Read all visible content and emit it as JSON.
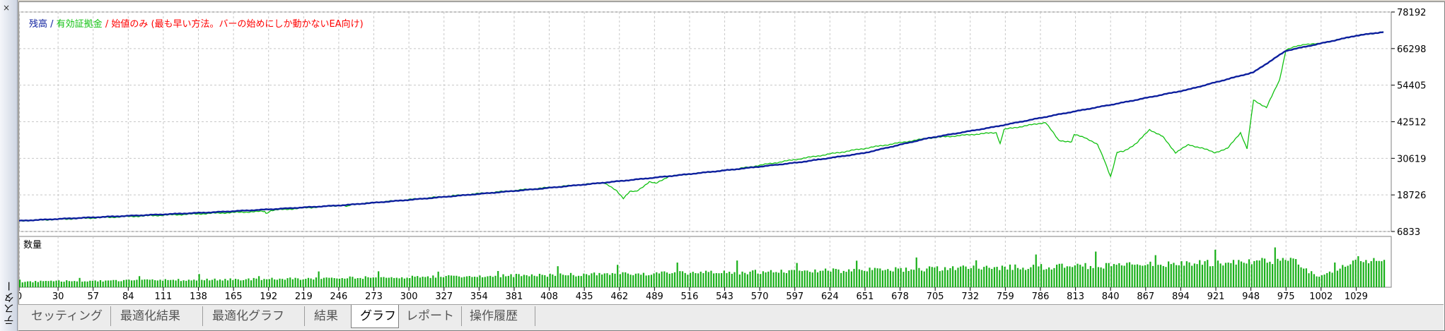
{
  "window": {
    "panel_title": "テスター",
    "close_glyph": "×"
  },
  "legend": {
    "balance": "残高",
    "sep1": " / ",
    "equity": "有効証拠金",
    "sep2": " / ",
    "note": "始値のみ (最も早い方法。バーの始めにしか動かないEA向け)"
  },
  "volume_label": "数量",
  "tabs": [
    {
      "label": "セッティング",
      "active": false
    },
    {
      "label": "最適化結果",
      "active": false
    },
    {
      "label": "最適化グラフ",
      "active": false
    },
    {
      "label": "結果",
      "active": false
    },
    {
      "label": "グラフ",
      "active": true
    },
    {
      "label": "レポート",
      "active": false
    },
    {
      "label": "操作履歴",
      "active": false
    }
  ],
  "colors": {
    "balance": "#0d1f9e",
    "equity": "#11c111",
    "note": "#ff0000",
    "volume": "#19b019",
    "grid": "#c8c8c8"
  },
  "chart_data": [
    {
      "type": "line",
      "title": "",
      "y_ticks": [
        78192,
        66298,
        54405,
        42512,
        30619,
        18726,
        6833
      ],
      "ylim": [
        6833,
        78192
      ],
      "xlim": [
        0,
        1056
      ],
      "grid": true,
      "series": [
        {
          "name": "残高",
          "x": [
            0,
            50,
            100,
            150,
            200,
            250,
            300,
            350,
            400,
            450,
            500,
            550,
            600,
            650,
            700,
            750,
            800,
            850,
            900,
            950,
            975,
            1000,
            1029,
            1050
          ],
          "y": [
            10300,
            11300,
            12200,
            13100,
            14200,
            15400,
            17100,
            18900,
            20700,
            22700,
            24800,
            27000,
            29300,
            32300,
            37200,
            40800,
            44900,
            48800,
            53000,
            58600,
            65600,
            67800,
            70500,
            71700
          ]
        },
        {
          "name": "有効証拠金",
          "x": [
            0,
            189,
            190,
            194,
            250,
            252,
            256,
            450,
            460,
            465,
            470,
            475,
            485,
            490,
            500,
            550,
            700,
            752,
            755,
            758,
            790,
            800,
            810,
            812,
            820,
            830,
            835,
            840,
            842,
            845,
            850,
            860,
            870,
            880,
            890,
            900,
            910,
            920,
            930,
            940,
            945,
            950,
            960,
            970,
            975,
            990,
            1000,
            1029,
            1050
          ],
          "y": [
            10300,
            13400,
            12700,
            13700,
            15400,
            14800,
            15600,
            22700,
            20000,
            17700,
            19800,
            19800,
            23000,
            22400,
            24800,
            27000,
            37200,
            39000,
            35400,
            40000,
            42300,
            36500,
            35900,
            38300,
            37500,
            35000,
            30300,
            24700,
            27700,
            32500,
            32900,
            35500,
            40000,
            37700,
            32500,
            35000,
            34000,
            32500,
            33800,
            39000,
            33700,
            49500,
            47200,
            56000,
            66000,
            67800,
            67800,
            70500,
            71700
          ]
        }
      ]
    },
    {
      "type": "bar",
      "title": "数量",
      "x_ticks": [
        "0",
        "30",
        "57",
        "84",
        "111",
        "138",
        "165",
        "192",
        "219",
        "246",
        "273",
        "300",
        "327",
        "354",
        "381",
        "408",
        "435",
        "462",
        "489",
        "516",
        "543",
        "570",
        "597",
        "624",
        "651",
        "678",
        "705",
        "732",
        "759",
        "786",
        "813",
        "840",
        "867",
        "894",
        "921",
        "948",
        "975",
        "1002",
        "1029"
      ],
      "xlim": [
        0,
        1056
      ],
      "ylim": [
        0,
        1
      ],
      "volume_profile": {
        "x": [
          0,
          100,
          200,
          300,
          400,
          500,
          600,
          700,
          800,
          850,
          900,
          950,
          980,
          1000,
          1029,
          1050
        ],
        "y": [
          0.12,
          0.15,
          0.18,
          0.22,
          0.26,
          0.3,
          0.34,
          0.4,
          0.44,
          0.48,
          0.5,
          0.55,
          0.58,
          0.2,
          0.6,
          0.55
        ]
      }
    }
  ]
}
